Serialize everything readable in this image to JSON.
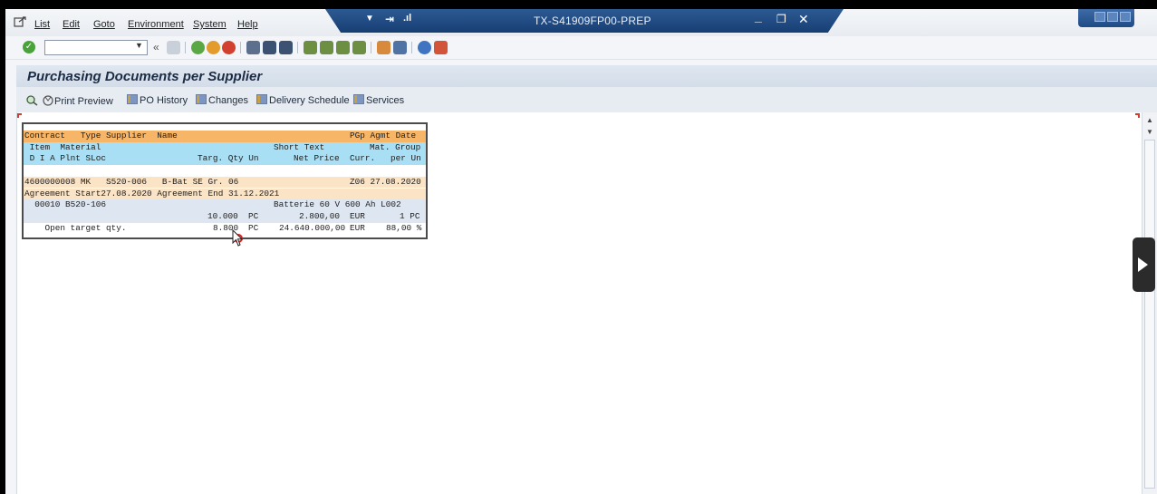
{
  "menu": {
    "items": [
      "List",
      "Edit",
      "Goto",
      "Environment",
      "System",
      "Help"
    ]
  },
  "window": {
    "title": "TX-S41909FP00-PREP"
  },
  "toolbar": {
    "command_field_value": ""
  },
  "page": {
    "title": "Purchasing Documents per Supplier"
  },
  "app_toolbar": {
    "buttons": [
      "Print Preview",
      "PO History",
      "Changes",
      "Delivery Schedule",
      "Services"
    ]
  },
  "report": {
    "header_rows": [
      {
        "left": "Contract   Type Supplier  Name",
        "right": "PGp Agmt Date"
      },
      {
        "left": " Item  Material",
        "mid": "Short Text",
        "right": "Mat. Group"
      },
      {
        "left": " D I A Plnt SLoc",
        "mid": "Targ. Qty Un",
        "mid2": "Net Price",
        "right": "Curr.   per Un"
      }
    ],
    "rows": [
      {
        "left": "4600000008 MK   S520-006   B-Bat SE Gr. 06",
        "right": "Z06 27.08.2020"
      },
      {
        "left": "Agreement Start27.08.2020 Agreement End 31.12.2021"
      },
      {
        "left": "  00010 B520-106",
        "mid": "Batterie 60 V 600 Ah L002"
      },
      {
        "qty": "10.000",
        "un": "PC",
        "price": "2.800,00",
        "curr": "EUR",
        "per": "1 PC"
      },
      {
        "left": "    Open target qty.",
        "qty": "8.800",
        "un": "PC",
        "price": "24.640.000,00",
        "curr": "EUR",
        "per": "88,00 %"
      }
    ]
  },
  "colors": {
    "header_orange": "#f7b567",
    "header_cyan": "#a8dff5",
    "title_bar": "#1e4a86"
  }
}
